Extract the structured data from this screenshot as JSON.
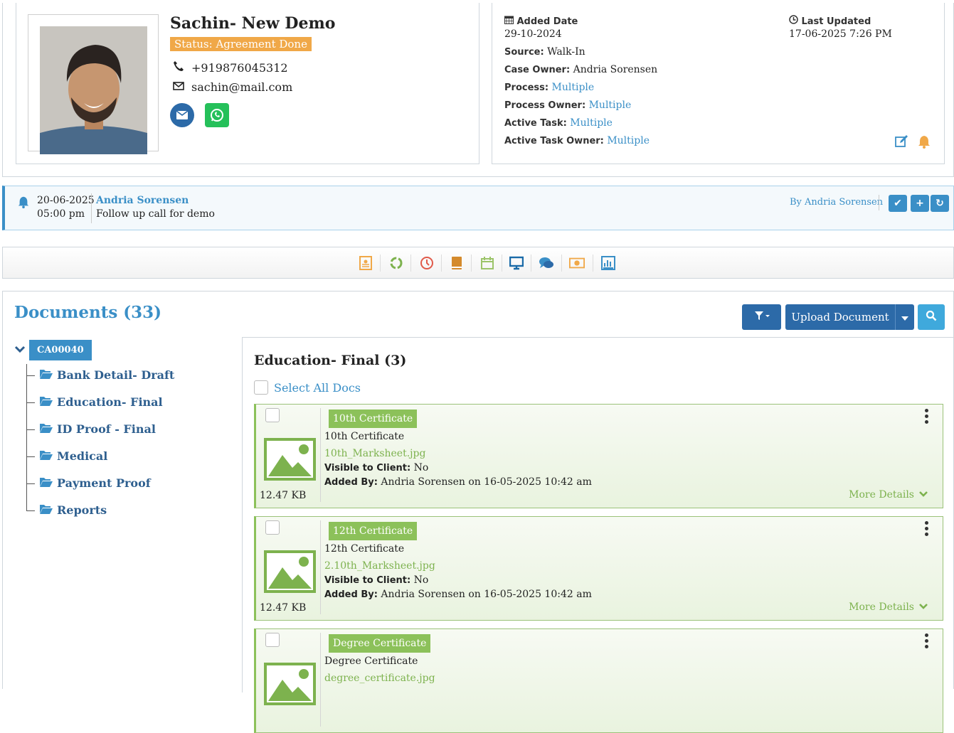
{
  "profile": {
    "name": "Sachin- New Demo",
    "status": "Status: Agreement Done",
    "phone": "+919876045312",
    "email": "sachin@mail.com"
  },
  "meta": {
    "added_date_label": "Added Date",
    "added_date": "29-10-2024",
    "last_updated_label": "Last Updated",
    "last_updated": "17-06-2025 7:26 PM",
    "source_label": "Source:",
    "source": "Walk-In",
    "case_owner_label": "Case Owner:",
    "case_owner": "Andria Sorensen",
    "process_label": "Process:",
    "process": "Multiple",
    "process_owner_label": "Process Owner:",
    "process_owner": "Multiple",
    "active_task_label": "Active Task:",
    "active_task": "Multiple",
    "active_task_owner_label": "Active Task Owner:",
    "active_task_owner": "Multiple"
  },
  "reminder": {
    "date": "20-06-2025",
    "time": "05:00 pm",
    "owner": "Andria Sorensen",
    "note": "Follow up call for demo",
    "by": "By Andria Sorensen"
  },
  "toolbar_icons": [
    "contact-card-icon",
    "recycle-icon",
    "clock-icon",
    "book-icon",
    "calendar-icon",
    "monitor-icon",
    "chat-icon",
    "money-icon",
    "report-icon"
  ],
  "documents": {
    "title": "Documents (33)",
    "upload_label": "Upload Document",
    "case_id": "CA00040",
    "folders": [
      {
        "label": "Bank Detail- Draft"
      },
      {
        "label": "Education- Final"
      },
      {
        "label": "ID Proof - Final"
      },
      {
        "label": "Medical"
      },
      {
        "label": "Payment Proof"
      },
      {
        "label": "Reports"
      }
    ],
    "folder_title": "Education- Final (3)",
    "select_all": "Select All Docs",
    "visible_label": "Visible to Client:",
    "added_by_label": "Added By:",
    "more_details": "More Details",
    "cards": [
      {
        "badge": "10th Certificate",
        "name": "10th Certificate",
        "file": "10th_Marksheet.jpg",
        "visible": "No",
        "added_by": "Andria Sorensen on 16-05-2025 10:42 am",
        "size": "12.47 KB"
      },
      {
        "badge": "12th Certificate",
        "name": "12th Certificate",
        "file": "2.10th_Marksheet.jpg",
        "visible": "No",
        "added_by": "Andria Sorensen on 16-05-2025 10:42 am",
        "size": "12.47 KB"
      },
      {
        "badge": "Degree Certificate",
        "name": "Degree Certificate",
        "file": "degree_certificate.jpg",
        "visible": "",
        "added_by": "",
        "size": ""
      }
    ]
  },
  "colors": {
    "accent": "#3a8fc7",
    "status": "#f0a848",
    "doc_green": "#8cc15a",
    "button_dark": "#2c6aa8"
  }
}
